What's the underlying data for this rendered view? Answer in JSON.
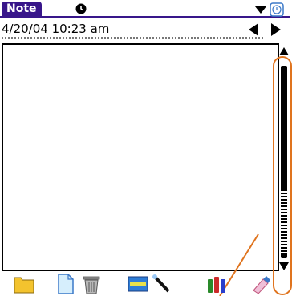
{
  "app": {
    "title": "Note"
  },
  "header": {
    "datetime": "4/20/04 10:23 am"
  },
  "icons": {
    "category": "alarm-icon",
    "menu": "dropdown-arrow-icon",
    "clock": "clock-icon",
    "nav_prev": "triangle-left-icon",
    "nav_next": "triangle-right-icon",
    "scroll_up": "arrow-up-icon",
    "scroll_down": "arrow-down-icon",
    "toolbar": [
      "folder-icon",
      "new-page-icon",
      "trash-icon",
      "color-bar-icon",
      "eraser-wand-icon",
      "pen-color-icon",
      "pencil-eraser-icon"
    ]
  },
  "colors": {
    "title_bar": "#38168a",
    "callout": "#e0741e",
    "folder": "#f3c32e",
    "page": "#d6eefc",
    "pen_red": "#cc2a2a",
    "pen_green": "#2a8a2a",
    "pen_blue": "#2a3ecc"
  }
}
